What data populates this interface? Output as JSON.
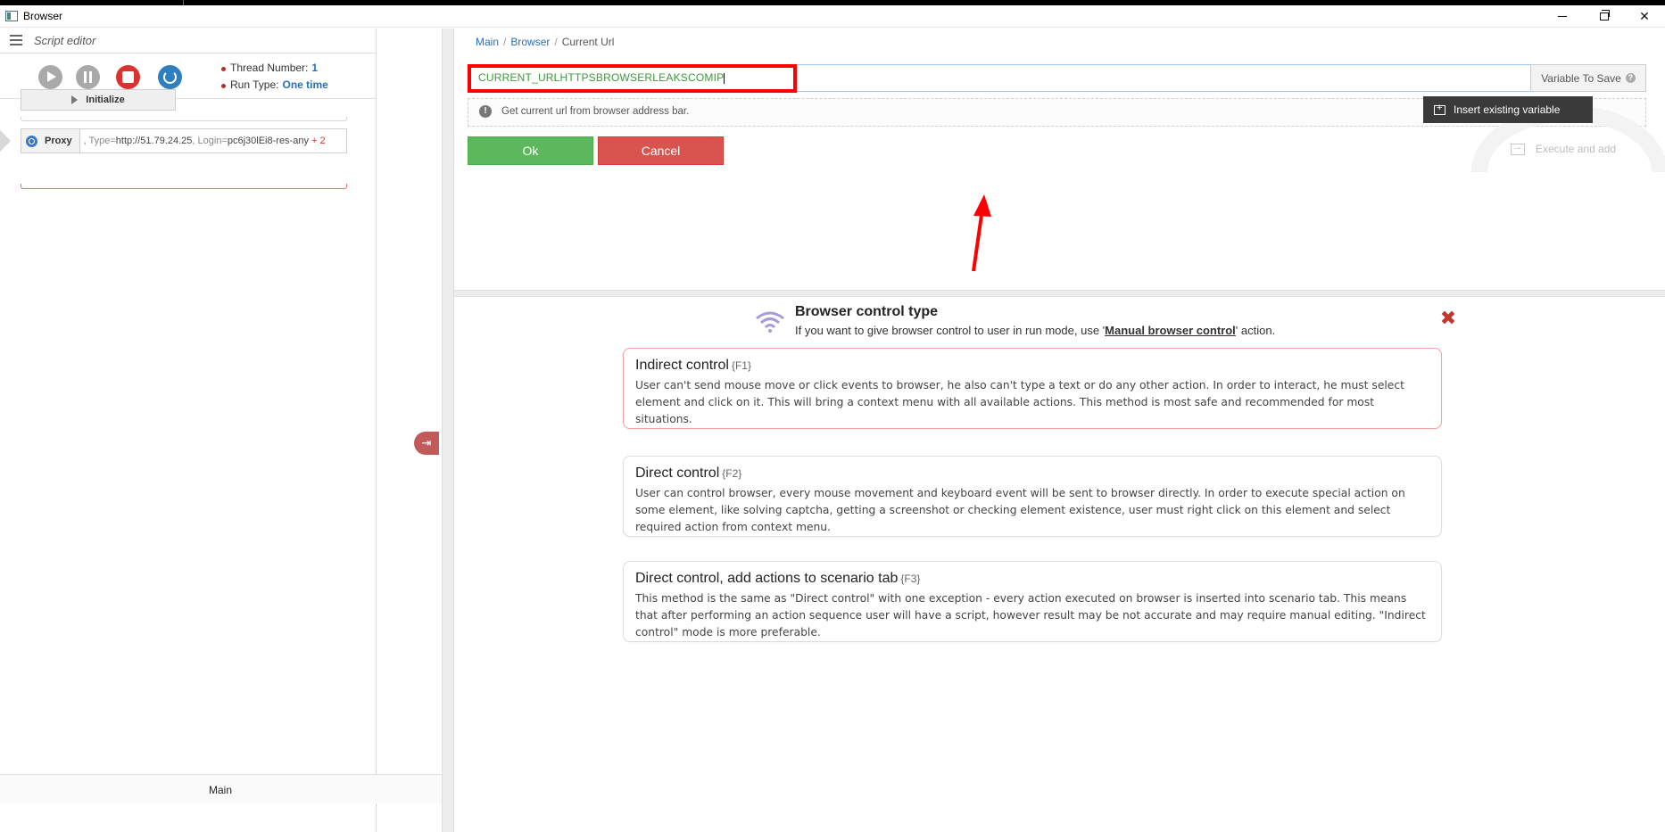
{
  "window": {
    "title": "Browser"
  },
  "left_panel": {
    "title": "Script editor",
    "thread_number_label": "Thread Number:",
    "thread_number_value": "1",
    "run_type_label": "Run Type:",
    "run_type_value": "One time",
    "initialize_label": "Initialize",
    "proxy": {
      "label": "Proxy",
      "param_prefix": ", Type=",
      "type_value": "http://51.79.24.25",
      "login_prefix": ", Login=",
      "login_value": "pc6j30lEi8-res-any",
      "more": "+ 2"
    },
    "footer_tab": "Main"
  },
  "right_panel": {
    "breadcrumb": [
      "Main",
      "Browser",
      "Current Url"
    ],
    "url_input_value": "CURRENT_URLHTTPSBROWSERLEAKSCOMIP",
    "variable_to_save_label": "Variable To Save",
    "hint_text": "Get current url from browser address bar.",
    "tooltip_text": "Insert existing variable",
    "ok_label": "Ok",
    "cancel_label": "Cancel",
    "execute_and_add_label": "Execute and add"
  },
  "browser_control": {
    "title": "Browser control type",
    "subtitle_prefix": "If you want to give browser control to user in run mode, use '",
    "subtitle_link": "Manual browser control",
    "subtitle_suffix": "' action.",
    "options": [
      {
        "title": "Indirect control",
        "key": "{F1}",
        "description": "User can't send mouse move or click events to browser, he also can't type a text or do any other action. In order to interact, he must select element and click on it. This will bring a context menu with all available actions. This method is most safe and recommended for most situations."
      },
      {
        "title": "Direct control",
        "key": "{F2}",
        "description": "User can control browser, every mouse movement and keyboard event will be sent to browser directly. In order to execute special action on some element, like solving captcha, getting a screenshot or checking element existence, user must right click on this element and select required action from context menu."
      },
      {
        "title": "Direct control, add actions to scenario tab",
        "key": "{F3}",
        "description": "This method is the same as \"Direct control\" with one exception - every action executed on browser is inserted into scenario tab. This means that after performing an action sequence user will have a script, however result may be not accurate and may require manual editing. \"Indirect control\" mode is more preferable."
      }
    ]
  },
  "colors": {
    "ok": "#5cb85c",
    "cancel": "#d9534f",
    "highlight": "#ff0000",
    "link": "#2a6fb5",
    "input_text": "#3a9a3a"
  }
}
